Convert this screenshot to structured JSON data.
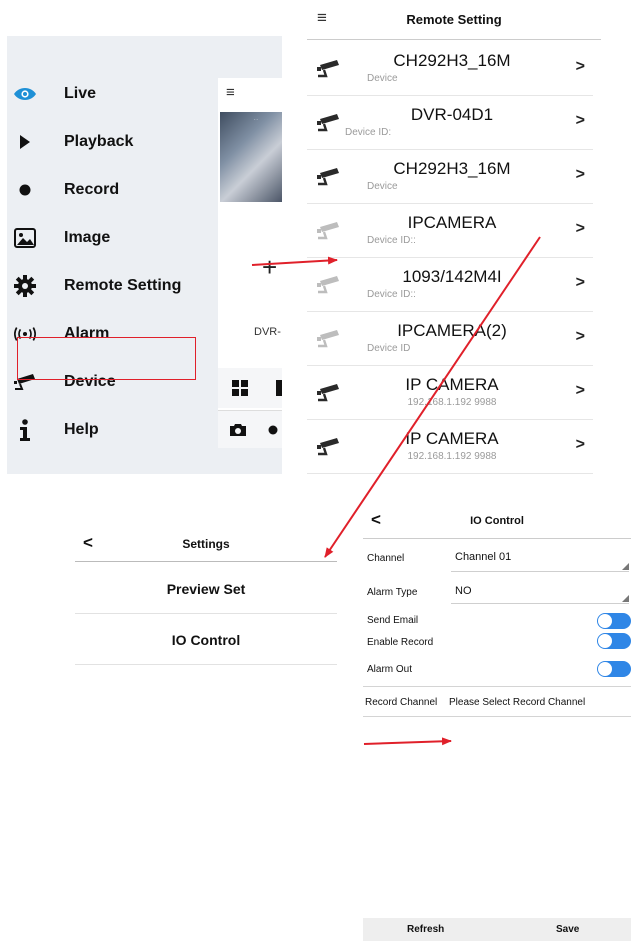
{
  "menu": {
    "items": [
      {
        "label": "Live",
        "icon": "eye-icon"
      },
      {
        "label": "Playback",
        "icon": "play-icon"
      },
      {
        "label": "Record",
        "icon": "record-dot-icon"
      },
      {
        "label": "Image",
        "icon": "image-icon"
      },
      {
        "label": "Remote Setting",
        "icon": "gear-icon"
      },
      {
        "label": "Alarm",
        "icon": "alarm-icon"
      },
      {
        "label": "Device",
        "icon": "camera-icon"
      },
      {
        "label": "Help",
        "icon": "info-icon"
      }
    ],
    "live_icon_color": "#1e90d6"
  },
  "live_preview": {
    "hamburger": "≡",
    "device_label": "DVR-",
    "add_symbol": "+"
  },
  "remote_setting": {
    "title": "Remote Setting",
    "devices": [
      {
        "name": "CH292H3_16M",
        "sub": "Device"
      },
      {
        "name": "DVR-04D1",
        "sub": "Device ID:"
      },
      {
        "name": "CH292H3_16M",
        "sub": "Device"
      },
      {
        "name": "IPCAMERA",
        "sub": "Device ID::"
      },
      {
        "name": "1093/142M4I",
        "sub": "Device ID::"
      },
      {
        "name": "IPCAMERA(2)",
        "sub": "Device ID"
      },
      {
        "name": "IP CAMERA",
        "sub": "192.168.1.192   9988"
      },
      {
        "name": "IP CAMERA",
        "sub": "192.168.1.192   9988"
      }
    ]
  },
  "settings": {
    "title": "Settings",
    "items": [
      "Preview Set",
      "IO Control"
    ]
  },
  "io_control": {
    "title": "IO Control",
    "channel_label": "Channel",
    "channel_value": "Channel 01",
    "alarm_type_label": "Alarm Type",
    "alarm_type_value": "NO",
    "send_email_label": "Send Email",
    "enable_record_label": "Enable Record",
    "alarm_out_label": "Alarm Out",
    "record_channel_label": "Record Channel",
    "record_channel_value": "Please Select Record Channel",
    "refresh_label": "Refresh",
    "save_label": "Save",
    "toggle_color": "#2f86e6"
  },
  "annotation_color": "#e0202a"
}
